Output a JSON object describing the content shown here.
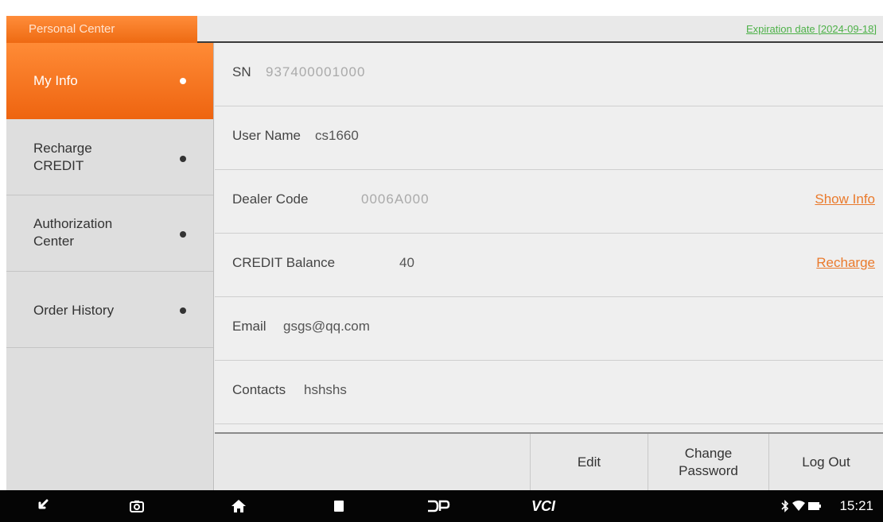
{
  "header": {
    "tab_title": "Personal Center",
    "expiration": "Expiration date [2024-09-18]"
  },
  "sidebar": {
    "items": [
      {
        "label": "My Info",
        "active": true
      },
      {
        "label": "Recharge\nCREDIT",
        "active": false
      },
      {
        "label": "Authorization\nCenter",
        "active": false
      },
      {
        "label": "Order History",
        "active": false
      }
    ]
  },
  "info": {
    "sn_label": "SN",
    "sn_value": "937400001000",
    "username_label": "User Name",
    "username_value": "cs1660",
    "dealer_label": "Dealer Code",
    "dealer_value": "0006A000",
    "dealer_link": "Show Info",
    "credit_label": "CREDIT Balance",
    "credit_value": "40",
    "credit_link": "Recharge",
    "email_label": "Email",
    "email_value": "gsgs@qq.com",
    "contacts_label": "Contacts",
    "contacts_value": "hshshs"
  },
  "buttons": {
    "edit": "Edit",
    "change_password": "Change\nPassword",
    "logout": "Log Out"
  },
  "navbar": {
    "vci": "VCI",
    "time": "15:21",
    "colors": {
      "accent": "#ee6a12",
      "link": "#ea7a2c",
      "expiry": "#4db148"
    }
  }
}
